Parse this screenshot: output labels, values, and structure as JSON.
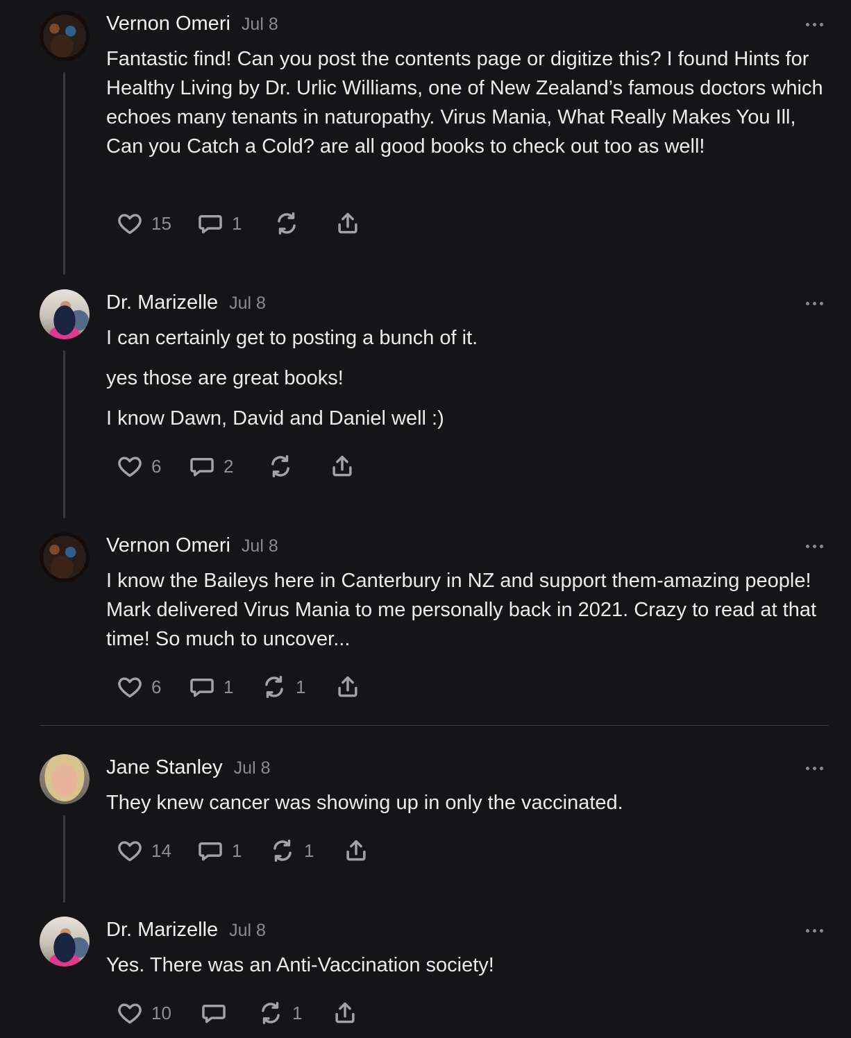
{
  "comments": [
    {
      "author": "Vernon Omeri",
      "date": "Jul 8",
      "paragraphs": [
        "Fantastic find! Can you post the contents page or digitize this? I found Hints for Healthy Living by Dr. Urlic Williams, one of New Zealand’s famous doctors which echoes many tenants in naturopathy. Virus Mania, What Really Makes You Ill, Can you Catch a Cold? are all good books to check out too as well!"
      ],
      "likes": "15",
      "replies": "1",
      "restacks": ""
    },
    {
      "author": "Dr. Marizelle",
      "date": "Jul 8",
      "paragraphs": [
        "I can certainly get to posting a bunch of it.",
        "yes those are great books!",
        "I know Dawn, David and Daniel well :)"
      ],
      "likes": "6",
      "replies": "2",
      "restacks": ""
    },
    {
      "author": "Vernon Omeri",
      "date": "Jul 8",
      "paragraphs": [
        "I know the Baileys here in Canterbury in NZ and support them-amazing people! Mark delivered Virus Mania to me personally back in 2021. Crazy to read at that time! So much to uncover..."
      ],
      "likes": "6",
      "replies": "1",
      "restacks": "1"
    },
    {
      "author": "Jane Stanley",
      "date": "Jul 8",
      "paragraphs": [
        "They knew cancer was showing up in only the vaccinated."
      ],
      "likes": "14",
      "replies": "1",
      "restacks": "1"
    },
    {
      "author": "Dr. Marizelle",
      "date": "Jul 8",
      "paragraphs": [
        "Yes. There was an Anti-Vaccination society!"
      ],
      "likes": "10",
      "replies": "",
      "restacks": "1"
    }
  ],
  "icons": {
    "like": "heart-icon",
    "reply": "speech-bubble-icon",
    "restack": "restack-icon",
    "share": "share-icon",
    "more": "more-dots-icon"
  }
}
